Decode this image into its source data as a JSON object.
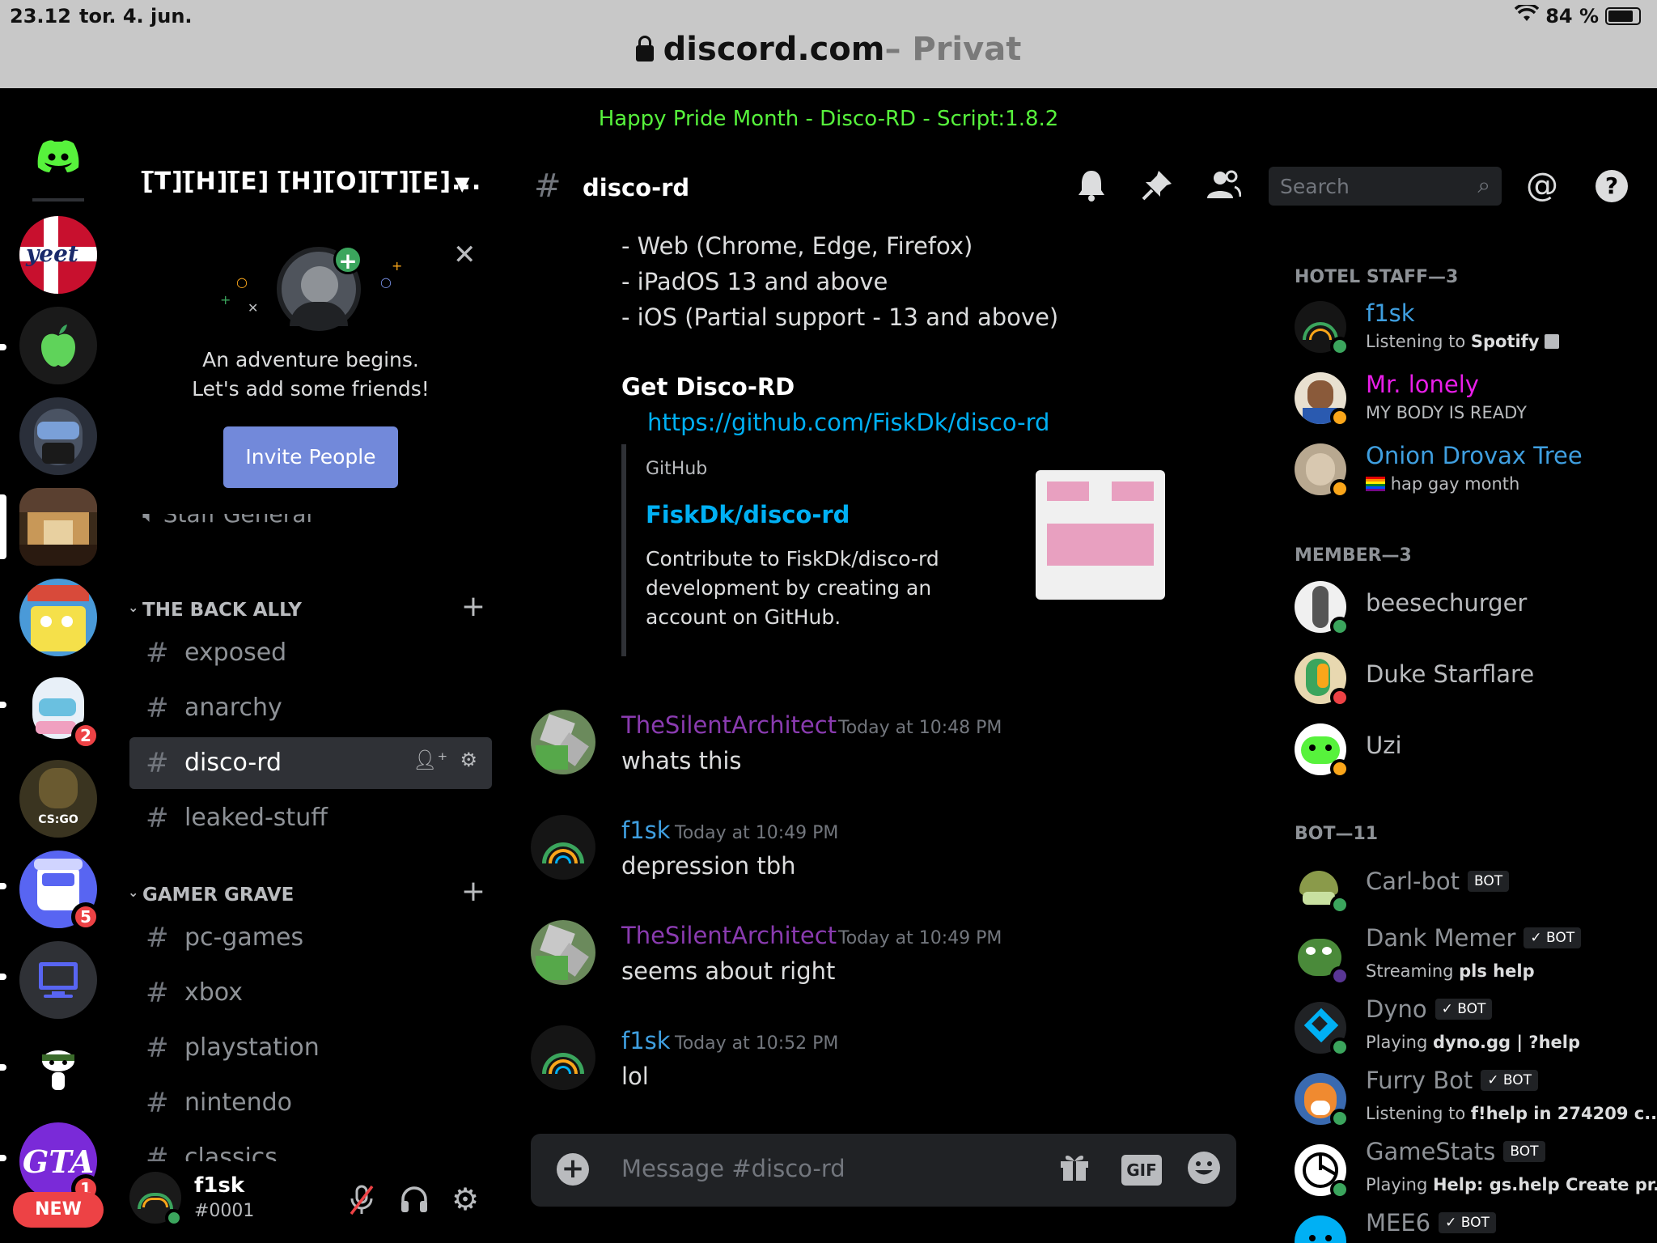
{
  "status_bar": {
    "time": "23.12",
    "date": "tor. 4. jun.",
    "battery": "84 %"
  },
  "browser": {
    "domain": "discord.com",
    "private_label": "– Privat"
  },
  "banner": {
    "text": "Happy Pride Month - Disco-RD - Script:1.8.2",
    "color": "#57f23c"
  },
  "servers": [
    {
      "name": "yeet",
      "badge": ""
    },
    {
      "name": "apple",
      "badge": ""
    },
    {
      "name": "masked",
      "badge": ""
    },
    {
      "name": "hotel",
      "badge": ""
    },
    {
      "name": "spongebob",
      "badge": ""
    },
    {
      "name": "furry",
      "badge": "2"
    },
    {
      "name": "csgo",
      "badge": ""
    },
    {
      "name": "robot",
      "badge": "5"
    },
    {
      "name": "computer",
      "badge": ""
    },
    {
      "name": "reddit",
      "badge": ""
    },
    {
      "name": "gta",
      "badge": "1"
    }
  ],
  "new_label": "NEW",
  "sidebar": {
    "server_name": "[̅T][̅H][̅E] [̅H][̅O][̅T][̅E]...",
    "welcome_line1": "An adventure begins.",
    "welcome_line2": "Let's add some friends!",
    "invite_label": "Invite People",
    "partial_channel": "Staff General",
    "categories": [
      {
        "name": "THE BACK ALLY",
        "channels": [
          "exposed",
          "anarchy",
          "disco-rd",
          "leaked-stuff"
        ]
      },
      {
        "name": "GAMER GRAVE",
        "channels": [
          "pc-games",
          "xbox",
          "playstation",
          "nintendo",
          "classics"
        ]
      }
    ]
  },
  "user": {
    "name": "f1sk",
    "discriminator": "#0001"
  },
  "chat": {
    "channel": "disco-rd",
    "support_lines": [
      "- Web (Chrome, Edge, Firefox)",
      "- iPadOS 13 and above",
      "- iOS (Partial support - 13 and above)"
    ],
    "get_title": "Get Disco-RD",
    "link": "https://github.com/FiskDk/disco-rd",
    "embed": {
      "provider": "GitHub",
      "title": "FiskDk/disco-rd",
      "description": "Contribute to FiskDk/disco-rd development by creating an account on GitHub."
    },
    "messages": [
      {
        "author": "TheSilentArchitect",
        "color": "#8a3bb0",
        "time": "Today at 10:48 PM",
        "text": "whats this"
      },
      {
        "author": "f1sk",
        "color": "#3f9fe0",
        "time": "Today at 10:49 PM",
        "text": "depression tbh"
      },
      {
        "author": "TheSilentArchitect",
        "color": "#8a3bb0",
        "time": "Today at 10:49 PM",
        "text": "seems about right"
      },
      {
        "author": "f1sk",
        "color": "#3f9fe0",
        "time": "Today at 10:52 PM",
        "text": "lol"
      }
    ],
    "composer_placeholder": "Message #disco-rd",
    "gif_label": "GIF"
  },
  "search": {
    "placeholder": "Search"
  },
  "members": {
    "groups": [
      {
        "title": "HOTEL STAFF—3"
      },
      {
        "title": "MEMBER—3"
      },
      {
        "title": "BOT—11"
      }
    ],
    "list": [
      {
        "name": "f1sk",
        "color": "#3f9fe0",
        "sub_prefix": "Listening to ",
        "sub_bold": "Spotify",
        "status": "online"
      },
      {
        "name": "Mr. lonely",
        "color": "#e91ee8",
        "sub_prefix": "MY BODY IS READY",
        "sub_bold": "",
        "status": "idle"
      },
      {
        "name": "Onion Drovax Tree",
        "color": "#3f9fe0",
        "sub_prefix": "hap gay month",
        "sub_bold": "",
        "status": "idle"
      },
      {
        "name": "beesechurger",
        "color": "#b9bbbe",
        "sub_prefix": "",
        "sub_bold": "",
        "status": "online"
      },
      {
        "name": "Duke Starflare",
        "color": "#b9bbbe",
        "sub_prefix": "",
        "sub_bold": "",
        "status": "dnd"
      },
      {
        "name": "Uzi",
        "color": "#b9bbbe",
        "sub_prefix": "",
        "sub_bold": "",
        "status": "idle"
      },
      {
        "name": "Carl-bot",
        "color": "#8e9297",
        "sub_prefix": "",
        "sub_bold": "",
        "status": "online",
        "tag": "BOT"
      },
      {
        "name": "Dank Memer",
        "color": "#8e9297",
        "sub_prefix": "Streaming ",
        "sub_bold": "pls help",
        "status": "streaming",
        "tag": "✓ BOT"
      },
      {
        "name": "Dyno",
        "color": "#8e9297",
        "sub_prefix": "Playing ",
        "sub_bold": "dyno.gg | ?help",
        "status": "online",
        "tag": "✓ BOT"
      },
      {
        "name": "Furry Bot",
        "color": "#8e9297",
        "sub_prefix": "Listening to ",
        "sub_bold": "f!help in 274209 c...",
        "status": "online",
        "tag": "✓ BOT"
      },
      {
        "name": "GameStats",
        "color": "#8e9297",
        "sub_prefix": "Playing ",
        "sub_bold": "Help: gs.help Create pr...",
        "status": "online",
        "tag": "BOT"
      },
      {
        "name": "MEE6",
        "color": "#8e9297",
        "sub_prefix": "",
        "sub_bold": "",
        "status": "online",
        "tag": "✓ BOT"
      }
    ]
  }
}
